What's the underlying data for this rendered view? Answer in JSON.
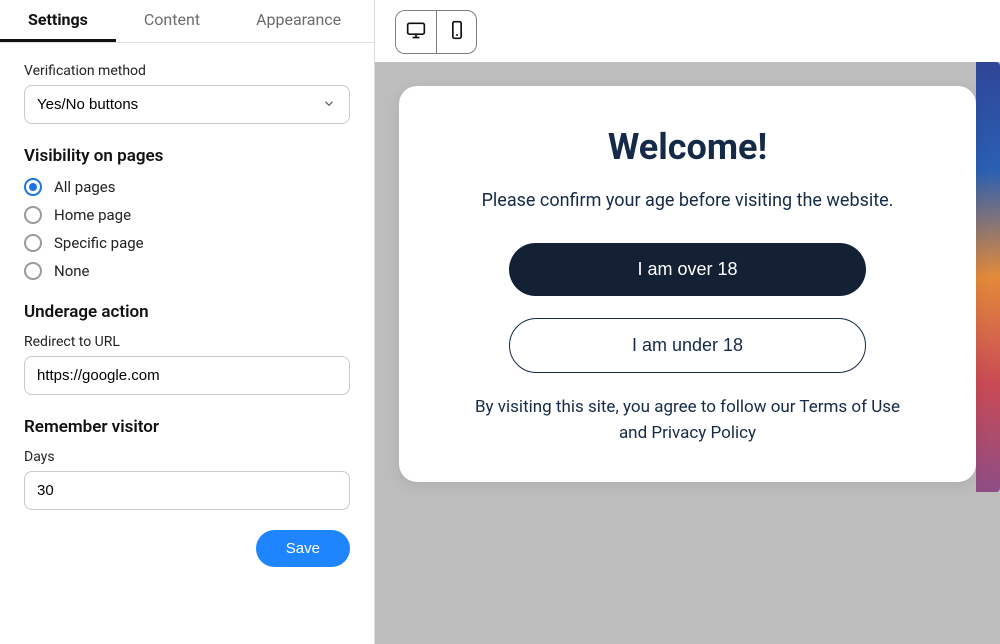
{
  "tabs": {
    "settings": "Settings",
    "content": "Content",
    "appearance": "Appearance"
  },
  "verification": {
    "label": "Verification method",
    "value": "Yes/No buttons"
  },
  "visibility": {
    "title": "Visibility on pages",
    "options": {
      "all": "All pages",
      "home": "Home page",
      "specific": "Specific page",
      "none": "None"
    }
  },
  "underage": {
    "title": "Underage action",
    "label": "Redirect to URL",
    "value": "https://google.com"
  },
  "remember": {
    "title": "Remember visitor",
    "label": "Days",
    "value": "30"
  },
  "save_label": "Save",
  "modal": {
    "title": "Welcome!",
    "subtitle": "Please confirm your age before visiting the website.",
    "over_btn": "I am over 18",
    "under_btn": "I am under 18",
    "footer": "By visiting this site, you agree to follow our Terms of Use and Privacy Policy"
  }
}
